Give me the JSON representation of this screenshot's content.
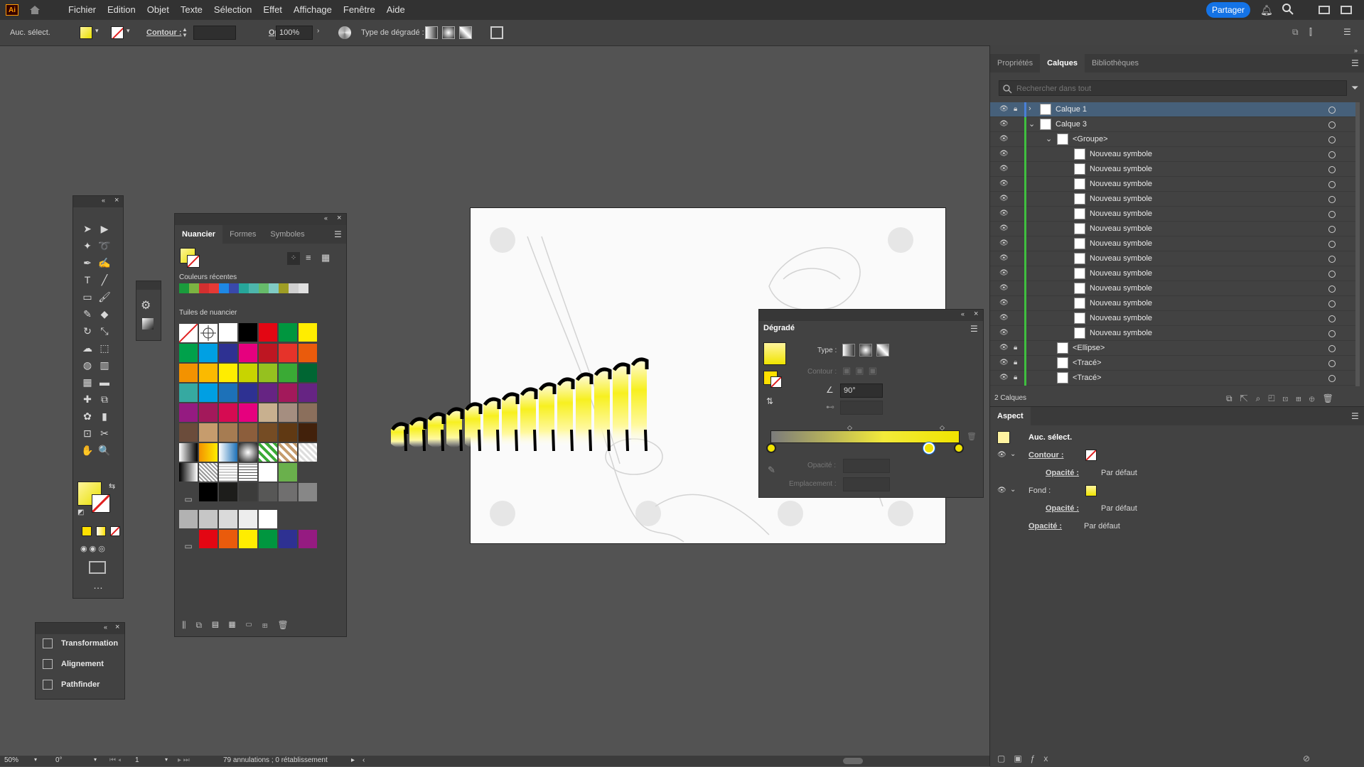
{
  "app": {
    "logo": "Ai",
    "share": "Partager"
  },
  "menu": [
    "Fichier",
    "Edition",
    "Objet",
    "Texte",
    "Sélection",
    "Effet",
    "Affichage",
    "Fenêtre",
    "Aide"
  ],
  "control": {
    "selection": "Auc. sélect.",
    "stroke_label": "Contour :",
    "opacity_label": "Opacité :",
    "opacity_value": "100%",
    "gradient_type_label": "Type de dégradé :"
  },
  "swatches_panel": {
    "tabs": [
      "Nuancier",
      "Formes",
      "Symboles"
    ],
    "recent_label": "Couleurs récentes",
    "tiles_label": "Tuiles de nuancier",
    "recent_colors": [
      "#1a9b3c",
      "#7cb342",
      "#d32f2f",
      "#e53935",
      "#1e88e5",
      "#3949ab",
      "#26a69a",
      "#4db6ac",
      "#66bb6a",
      "#80cbc4",
      "#9e9d24",
      "#cfcfcf",
      "#e0e0e0"
    ],
    "tiles": [
      [
        "#ffffff",
        "#ffffff",
        "#ffffff",
        "#000000",
        "#e30613",
        "#00963f",
        "#ffed00"
      ],
      [
        "#00a14b",
        "#00a0e3",
        "#2e3192",
        "#e6007e",
        "#be1622",
        "#e6332a",
        "#ea5b0c"
      ],
      [
        "#f39200",
        "#fbba00",
        "#ffed00",
        "#c8d400",
        "#95c11f",
        "#3aaa35",
        "#006633"
      ],
      [
        "#36a9a1",
        "#009fe3",
        "#1d71b8",
        "#2e3192",
        "#662483",
        "#a3195b",
        "#662483"
      ],
      [
        "#951b81",
        "#a3195b",
        "#d60b52",
        "#e6007e",
        "#c8b08f",
        "#a58e80",
        "#8b6f5c"
      ],
      [
        "#6b4c3b",
        "#c69c6d",
        "#a67c52",
        "#8c5e3c",
        "#754c24",
        "#603913",
        "#42210b"
      ]
    ],
    "grays": [
      "#000000",
      "#1d1d1b",
      "#3c3c3b",
      "#575756",
      "#706f6f",
      "#878787",
      "#9d9d9c"
    ],
    "grays2": [
      "#b2b2b2",
      "#c6c6c6",
      "#dadada",
      "#ededed",
      "#ffffff"
    ],
    "last_row": [
      "#e30613",
      "#ea5b0c",
      "#ffed00",
      "#00963f",
      "#2e3192",
      "#951b81"
    ]
  },
  "gradient_panel": {
    "title": "Dégradé",
    "type_label": "Type :",
    "stroke_label": "Contour :",
    "angle": "90°",
    "opacity_label": "Opacité :",
    "location_label": "Emplacement :"
  },
  "tools_panel": {
    "items": [
      "Transformation",
      "Alignement",
      "Pathfinder"
    ]
  },
  "right_panel": {
    "tabs": [
      "Propriétés",
      "Calques",
      "Bibliothèques"
    ],
    "search_placeholder": "Rechercher dans tout",
    "layers": [
      {
        "name": "Calque 1",
        "indent": 0,
        "selected": true,
        "lock": true
      },
      {
        "name": "Calque 3",
        "indent": 0,
        "selected": false,
        "lock": false
      },
      {
        "name": "<Groupe>",
        "indent": 1,
        "selected": false,
        "lock": false
      },
      {
        "name": "Nouveau symbole",
        "indent": 2
      },
      {
        "name": "Nouveau symbole",
        "indent": 2
      },
      {
        "name": "Nouveau symbole",
        "indent": 2
      },
      {
        "name": "Nouveau symbole",
        "indent": 2
      },
      {
        "name": "Nouveau symbole",
        "indent": 2
      },
      {
        "name": "Nouveau symbole",
        "indent": 2
      },
      {
        "name": "Nouveau symbole",
        "indent": 2
      },
      {
        "name": "Nouveau symbole",
        "indent": 2
      },
      {
        "name": "Nouveau symbole",
        "indent": 2
      },
      {
        "name": "Nouveau symbole",
        "indent": 2
      },
      {
        "name": "Nouveau symbole",
        "indent": 2
      },
      {
        "name": "Nouveau symbole",
        "indent": 2
      },
      {
        "name": "Nouveau symbole",
        "indent": 2
      },
      {
        "name": "<Ellipse>",
        "indent": 1,
        "lock": true
      },
      {
        "name": "<Tracé>",
        "indent": 1,
        "lock": true
      },
      {
        "name": "<Tracé>",
        "indent": 1,
        "lock": true
      }
    ],
    "layers_count": "2 Calques",
    "aspect_title": "Aspect",
    "aspect_selection": "Auc. sélect.",
    "aspect_stroke": "Contour :",
    "aspect_fill": "Fond :",
    "aspect_opacity": "Opacité :",
    "aspect_default": "Par défaut"
  },
  "status": {
    "zoom": "50%",
    "angle": "0°",
    "page": "1",
    "history": "79 annulations ; 0 rétablissement"
  }
}
